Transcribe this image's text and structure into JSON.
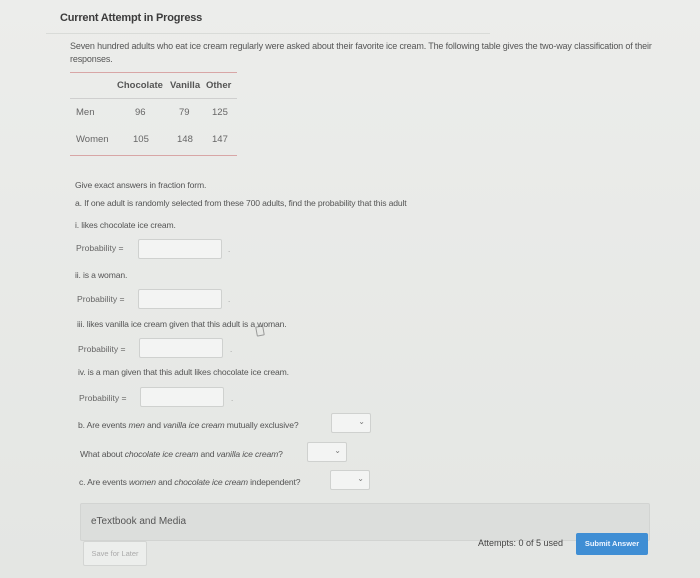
{
  "header": {
    "title": "Current Attempt in Progress"
  },
  "intro": "Seven hundred adults who eat ice cream regularly were asked about their favorite ice cream. The following table gives the two-way classification of their responses.",
  "table": {
    "columns": [
      "Chocolate",
      "Vanilla",
      "Other"
    ],
    "rows": [
      {
        "label": "Men",
        "values": [
          "96",
          "79",
          "125"
        ]
      },
      {
        "label": "Women",
        "values": [
          "105",
          "148",
          "147"
        ]
      }
    ]
  },
  "instructions": "Give exact answers in fraction form.",
  "part_a": {
    "prompt": "a. If one adult is randomly selected from these 700 adults, find the probability that this adult",
    "items": [
      {
        "text": "i. likes chocolate ice cream.",
        "label": "Probability =",
        "value": ""
      },
      {
        "text": "ii. is a woman.",
        "label": "Probability =",
        "value": ""
      },
      {
        "text": "iii. likes vanilla ice cream given that this adult is a woman.",
        "label": "Probability =",
        "value": ""
      },
      {
        "text": "iv. is a man given that this adult likes chocolate ice cream.",
        "label": "Probability =",
        "value": ""
      }
    ]
  },
  "part_b": {
    "q1_pre": "b. Are events ",
    "q1_e1": "men",
    "q1_mid": " and ",
    "q1_e2": "vanilla ice cream",
    "q1_post": " mutually exclusive?",
    "q2_pre": "What about ",
    "q2_e1": "chocolate ice cream",
    "q2_mid": " and ",
    "q2_e2": "vanilla ice cream",
    "q2_post": "?",
    "selected_1": "",
    "selected_2": ""
  },
  "part_c": {
    "q_pre": "c. Are events ",
    "q_e1": "women",
    "q_mid": " and ",
    "q_e2": "chocolate ice cream",
    "q_post": " independent?",
    "selected": ""
  },
  "footer": {
    "etextbook": "eTextbook and Media",
    "save": "Save for Later",
    "attempts": "Attempts: 0 of 5 used",
    "submit": "Submit Answer"
  },
  "icons": {
    "dropdown": "chevron-down-icon",
    "chevron_glyph": "⌄",
    "dot": "."
  },
  "colors": {
    "submit_bg": "#3f8ed4",
    "table_rule": "#d8a6a6"
  }
}
